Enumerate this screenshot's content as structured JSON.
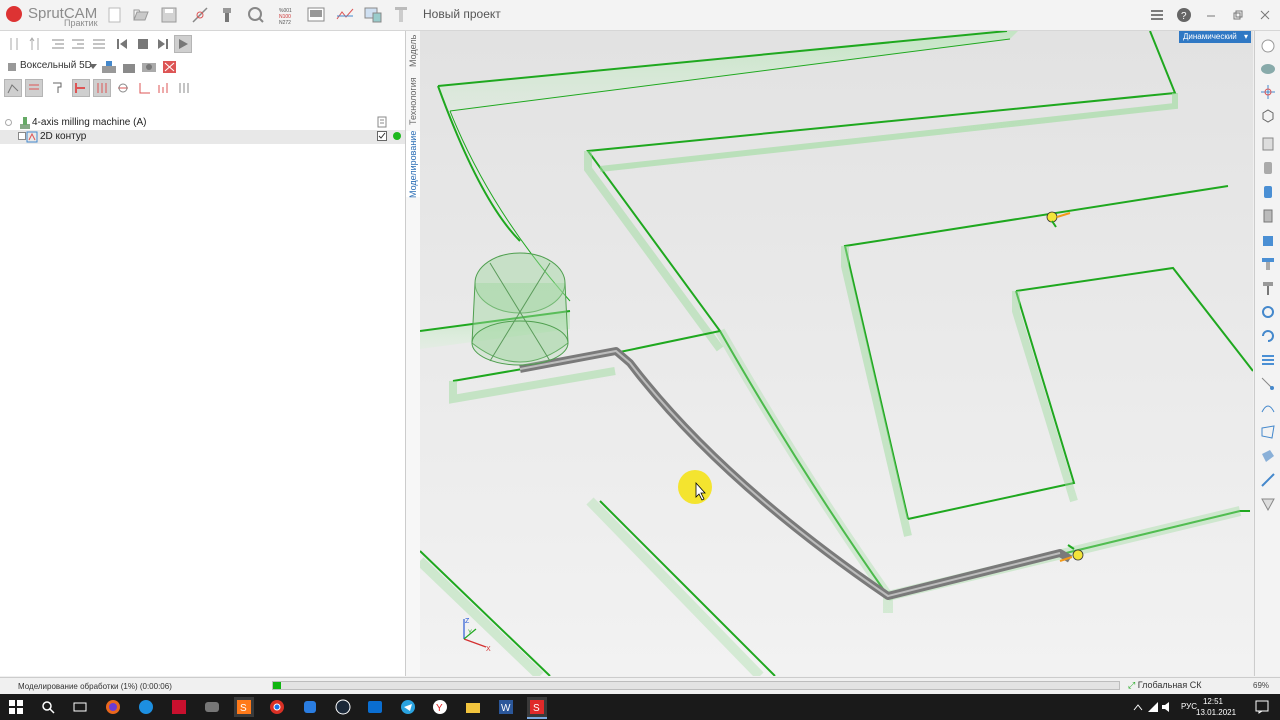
{
  "app": {
    "brand": "SprutCAM",
    "edition": "Практик",
    "project_title": "Новый проект"
  },
  "left_panel": {
    "mode_select": "Воксельный 5D",
    "tree": [
      {
        "label": "4-axis milling machine (A)"
      },
      {
        "label": "2D контур"
      }
    ]
  },
  "side_tabs": [
    "Модель",
    "Технология",
    "Моделирование"
  ],
  "viewport": {
    "view_mode": "Динамический",
    "axis_labels": {
      "x": "X",
      "y": "Y",
      "z": "Z"
    }
  },
  "status": {
    "text": "Моделирование обработки (1%) (0:00:06)",
    "progress": 0.01,
    "coord_system": "Глобальная СК",
    "zoom": "69%"
  },
  "taskbar": {
    "lang": "РУС",
    "time": "12:51",
    "date": "13.01.2021"
  },
  "colors": {
    "accent": "#2f78c4",
    "contour": "#1fa81f",
    "progress": "#10b510"
  }
}
